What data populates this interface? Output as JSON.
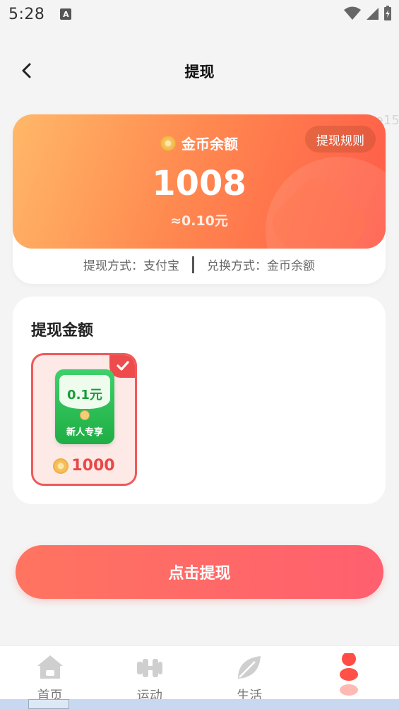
{
  "status_bar": {
    "time": "5:28",
    "notification_icon": "A"
  },
  "header": {
    "title": "提现",
    "back_icon": "chevron-left-icon"
  },
  "watermark": "fabe15",
  "balance_card": {
    "label": "金币余额",
    "rules_button": "提现规则",
    "amount": "1008",
    "rmb_value": "≈0.10元",
    "withdraw_method": "提现方式：支付宝",
    "exchange_method": "兑换方式：金币余额"
  },
  "amount_section": {
    "title": "提现金额",
    "options": [
      {
        "amount": "0.1元",
        "tag": "新人专享",
        "cost": "1000",
        "selected": true
      }
    ]
  },
  "submit_button": "点击提现",
  "tab_bar": {
    "tabs": [
      {
        "label": "首页",
        "icon": "home-icon"
      },
      {
        "label": "运动",
        "icon": "dumbbell-icon"
      },
      {
        "label": "生活",
        "icon": "leaf-icon"
      },
      {
        "label": "",
        "icon": "profile-icon"
      }
    ]
  },
  "colors": {
    "accent": "#ff5f5f",
    "card_gradient_start": "#ffb868",
    "card_gradient_end": "#ff5a48",
    "envelope_green": "#2fc457"
  }
}
